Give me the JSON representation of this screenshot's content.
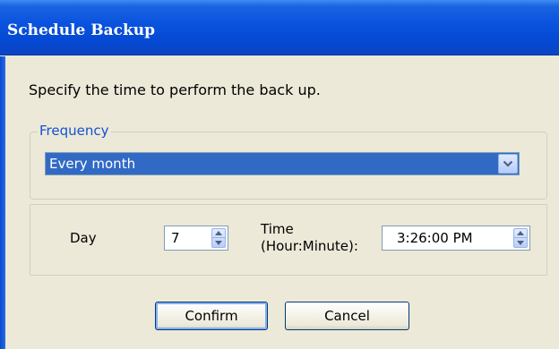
{
  "window": {
    "title": "Schedule Backup"
  },
  "instruction": "Specify the time to perform the back up.",
  "frequency": {
    "legend": "Frequency",
    "selected": "Every month"
  },
  "schedule": {
    "day_label": "Day",
    "day_value": "7",
    "time_label_line1": "Time",
    "time_label_line2": "(Hour:Minute):",
    "time_value": "3:26:00 PM"
  },
  "buttons": {
    "confirm": "Confirm",
    "cancel": "Cancel"
  },
  "icons": {
    "dropdown": "chevron-down-icon",
    "spin_up": "spin-up-icon",
    "spin_down": "spin-down-icon"
  }
}
